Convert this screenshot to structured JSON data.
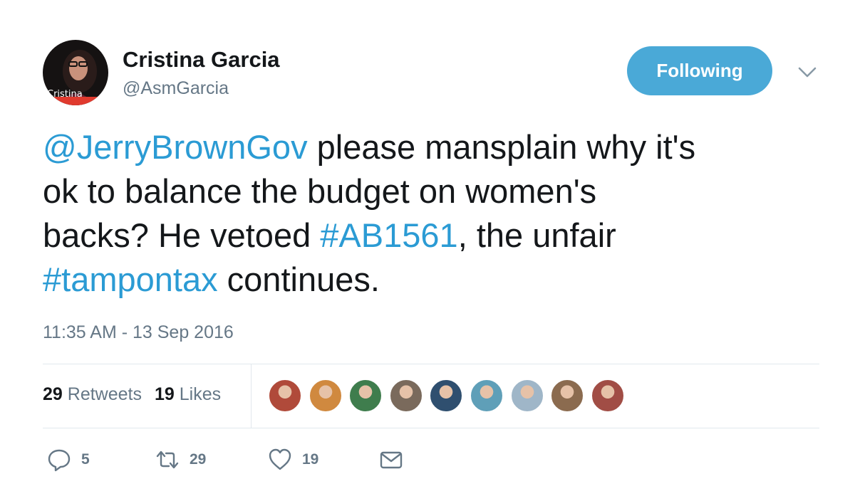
{
  "tweet": {
    "author": {
      "name": "Cristina Garcia",
      "handle": "@AsmGarcia",
      "avatar_caption": "Cristina"
    },
    "follow_button": "Following",
    "menu_icon": "chevron-down-icon",
    "text_lines": [
      [
        {
          "t": "@JerryBrownGov",
          "link": true
        },
        {
          "t": " please mansplain why it's",
          "link": false
        }
      ],
      [
        {
          "t": "ok to balance the budget on women's",
          "link": false
        }
      ],
      [
        {
          "t": "backs? He vetoed ",
          "link": false
        },
        {
          "t": "#AB1561",
          "link": true
        },
        {
          "t": ", the unfair",
          "link": false
        }
      ],
      [
        {
          "t": "#tampontax",
          "link": true
        },
        {
          "t": " continues.",
          "link": false
        }
      ]
    ],
    "timestamp": "11:35 AM - 13 Sep 2016",
    "stats": {
      "retweets_count": "29",
      "retweets_label": "Retweets",
      "likes_count": "19",
      "likes_label": "Likes"
    },
    "liker_avatars": [
      "#b04a3a",
      "#d0893f",
      "#3f7d4d",
      "#7a6a5c",
      "#2f4f6f",
      "#5f9fb8",
      "#9fb6c8",
      "#8b6b4f",
      "#a14d45"
    ],
    "actions": {
      "reply_count": "5",
      "retweet_count": "29",
      "like_count": "19"
    }
  },
  "colors": {
    "link": "#2b9bd4",
    "follow_button": "#4aa9d7",
    "muted": "#657786",
    "divider": "#e1e8ed"
  }
}
